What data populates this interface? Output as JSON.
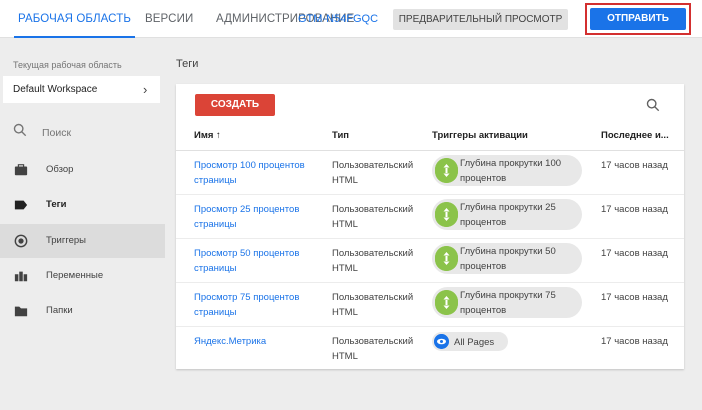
{
  "header": {
    "tabs": [
      {
        "label": "РАБОЧАЯ ОБЛАСТЬ",
        "active": true
      },
      {
        "label": "ВЕРСИИ",
        "active": false
      },
      {
        "label": "АДМИНИСТРИРОВАНИЕ",
        "active": false
      }
    ],
    "workspace_id": "GTM-N54FGQC",
    "preview_label": "ПРЕДВАРИТЕЛЬНЫЙ ПРОСМОТР",
    "submit_label": "ОТПРАВИТЬ",
    "accent_color": "#1a73e8",
    "highlight_color": "#d32f2f"
  },
  "sidebar": {
    "workspace_label": "Текущая рабочая область",
    "workspace_name": "Default Workspace",
    "search_placeholder": "Поиск",
    "items": [
      {
        "label": "Обзор",
        "icon": "briefcase-icon"
      },
      {
        "label": "Теги",
        "icon": "tag-icon"
      },
      {
        "label": "Триггеры",
        "icon": "trigger-icon"
      },
      {
        "label": "Переменные",
        "icon": "variables-icon"
      },
      {
        "label": "Папки",
        "icon": "folder-icon"
      }
    ]
  },
  "main": {
    "title": "Теги",
    "create_label": "СОЗДАТЬ",
    "columns": [
      "Имя ↑",
      "Тип",
      "Триггеры активации",
      "Последнее и..."
    ],
    "rows": [
      {
        "name": "Просмотр 100 процентов страницы",
        "type": "Пользовательский HTML",
        "trigger": "Глубина прокрутки 100 процентов",
        "trigger_icon": "scroll-depth-icon",
        "modified": "17 часов назад"
      },
      {
        "name": "Просмотр 25 процентов страницы",
        "type": "Пользовательский HTML",
        "trigger": "Глубина прокрутки 25 процентов",
        "trigger_icon": "scroll-depth-icon",
        "modified": "17 часов назад"
      },
      {
        "name": "Просмотр 50 процентов страницы",
        "type": "Пользовательский HTML",
        "trigger": "Глубина прокрутки 50 процентов",
        "trigger_icon": "scroll-depth-icon",
        "modified": "17 часов назад"
      },
      {
        "name": "Просмотр 75 процентов страницы",
        "type": "Пользовательский HTML",
        "trigger": "Глубина прокрутки 75 процентов",
        "trigger_icon": "scroll-depth-icon",
        "modified": "17 часов назад"
      },
      {
        "name": "Яндекс.Метрика",
        "type": "Пользовательский HTML",
        "trigger": "All Pages",
        "trigger_icon": "pageview-icon",
        "modified": "17 часов назад"
      }
    ]
  }
}
